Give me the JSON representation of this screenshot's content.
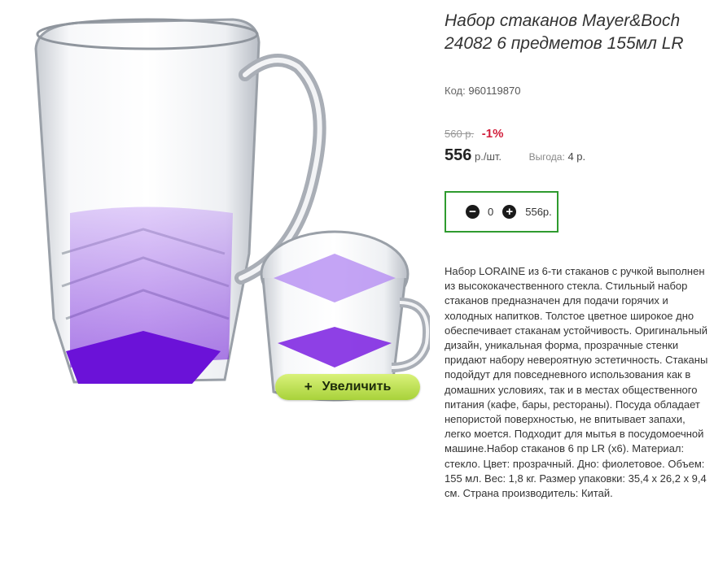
{
  "product": {
    "title": "Набор стаканов Mayer&Boch 24082 6 предметов 155мл LR",
    "code_label": "Код:",
    "code_value": "960119870",
    "old_price": "560 р.",
    "discount": "-1%",
    "price": "556",
    "price_unit": "р./шт.",
    "saving_label": "Выгода:",
    "saving_value": "4 р.",
    "description": "Набор LORAINE из 6-ти стаканов с ручкой выполнен из высококачественного стекла. Стильный набор стаканов предназначен для подачи горячих и холодных напитков. Толстое цветное широкое дно обеспечивает стаканам устойчивость. Оригинальный дизайн, уникальная форма, прозрачные стенки придают набору невероятную эстетичность. Стаканы подойдут для повседневного использования как в домашних условиях, так и в местах общественного питания (кафе, бары, рестораны). Посуда обладает непористой поверхностью, не впитывает запахи, легко моется. Подходит для мытья в посудомоечной машине.Набор стаканов 6 пр LR (x6). Материал: стекло. Цвет: прозрачный. Дно: фиолетовое. Объем: 155 мл. Вес: 1,8 кг. Размер упаковки: 35,4 x 26,2 x 9,4 см. Страна производитель: Китай."
  },
  "cart": {
    "minus_icon": "minus-circle-icon",
    "plus_icon": "plus-circle-icon",
    "quantity": "0",
    "sum": "556р."
  },
  "zoom": {
    "label": "Увеличить",
    "icon": "+"
  },
  "colors": {
    "accent_border": "#2f9b2f",
    "discount": "#d21f3c",
    "zoom_button": "#b8dc4a",
    "glass_bottom": "#7a1fe0"
  }
}
